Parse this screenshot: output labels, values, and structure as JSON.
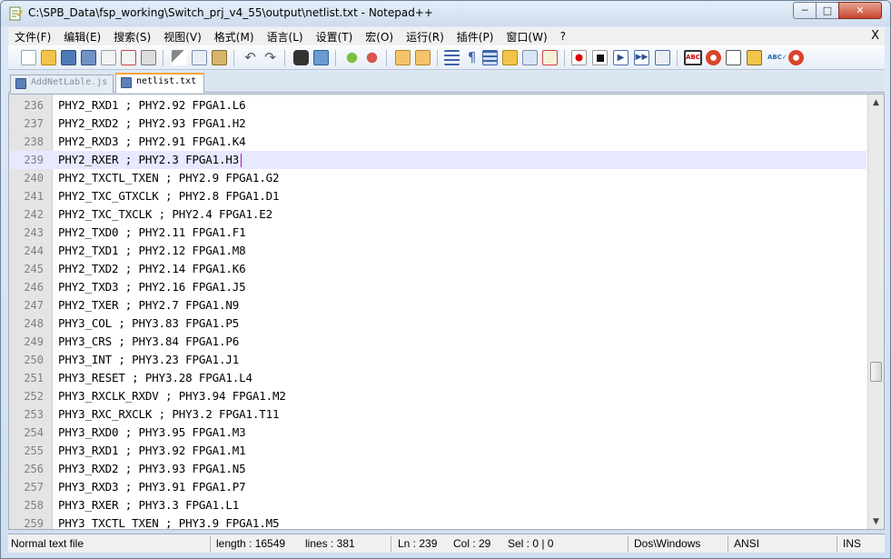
{
  "window": {
    "title": "C:\\SPB_Data\\fsp_working\\Switch_prj_v4_55\\output\\netlist.txt - Notepad++",
    "min_label": "─",
    "max_label": "□",
    "close_label": "✕"
  },
  "menu": {
    "items": [
      "文件(F)",
      "编辑(E)",
      "搜索(S)",
      "视图(V)",
      "格式(M)",
      "语言(L)",
      "设置(T)",
      "宏(O)",
      "运行(R)",
      "插件(P)",
      "窗口(W)",
      "?"
    ],
    "close_label": "X"
  },
  "toolbar": {
    "icons": [
      "new-file-icon",
      "open-file-icon",
      "save-icon",
      "save-all-icon",
      "close-icon",
      "close-all-icon",
      "print-icon",
      "cut-icon",
      "copy-icon",
      "paste-icon",
      "undo-icon",
      "redo-icon",
      "find-icon",
      "replace-icon",
      "zoom-in-icon",
      "zoom-out-icon",
      "sync-vertical-icon",
      "sync-horizontal-icon",
      "word-wrap-icon",
      "show-all-chars-icon",
      "indent-guide-icon",
      "folder-as-workspace-icon",
      "doc-map-icon",
      "function-list-icon",
      "record-macro-icon",
      "stop-macro-icon",
      "play-macro-icon",
      "run-macro-multiple-icon",
      "save-macro-icon",
      "spell-check-icon",
      "plugin-star-icon",
      "console-icon",
      "plugin-folder-icon",
      "abc-check-icon",
      "plugin-star2-icon"
    ]
  },
  "tabs": [
    {
      "label": "AddNetLable.js",
      "active": false
    },
    {
      "label": "netlist.txt",
      "active": true
    }
  ],
  "editor": {
    "current_line": 239,
    "lines": [
      {
        "n": "236",
        "text": "PHY2_RXD1 ; PHY2.92 FPGA1.L6"
      },
      {
        "n": "237",
        "text": "PHY2_RXD2 ; PHY2.93 FPGA1.H2"
      },
      {
        "n": "238",
        "text": "PHY2_RXD3 ; PHY2.91 FPGA1.K4"
      },
      {
        "n": "239",
        "text": "PHY2_RXER ; PHY2.3 FPGA1.H3"
      },
      {
        "n": "240",
        "text": "PHY2_TXCTL_TXEN ; PHY2.9 FPGA1.G2"
      },
      {
        "n": "241",
        "text": "PHY2_TXC_GTXCLK ; PHY2.8 FPGA1.D1"
      },
      {
        "n": "242",
        "text": "PHY2_TXC_TXCLK ; PHY2.4 FPGA1.E2"
      },
      {
        "n": "243",
        "text": "PHY2_TXD0 ; PHY2.11 FPGA1.F1"
      },
      {
        "n": "244",
        "text": "PHY2_TXD1 ; PHY2.12 FPGA1.M8"
      },
      {
        "n": "245",
        "text": "PHY2_TXD2 ; PHY2.14 FPGA1.K6"
      },
      {
        "n": "246",
        "text": "PHY2_TXD3 ; PHY2.16 FPGA1.J5"
      },
      {
        "n": "247",
        "text": "PHY2_TXER ; PHY2.7 FPGA1.N9"
      },
      {
        "n": "248",
        "text": "PHY3_COL ; PHY3.83 FPGA1.P5"
      },
      {
        "n": "249",
        "text": "PHY3_CRS ; PHY3.84 FPGA1.P6"
      },
      {
        "n": "250",
        "text": "PHY3_INT ; PHY3.23 FPGA1.J1"
      },
      {
        "n": "251",
        "text": "PHY3_RESET ; PHY3.28 FPGA1.L4"
      },
      {
        "n": "252",
        "text": "PHY3_RXCLK_RXDV ; PHY3.94 FPGA1.M2"
      },
      {
        "n": "253",
        "text": "PHY3_RXC_RXCLK ; PHY3.2 FPGA1.T11"
      },
      {
        "n": "254",
        "text": "PHY3_RXD0 ; PHY3.95 FPGA1.M3"
      },
      {
        "n": "255",
        "text": "PHY3_RXD1 ; PHY3.92 FPGA1.M1"
      },
      {
        "n": "256",
        "text": "PHY3_RXD2 ; PHY3.93 FPGA1.N5"
      },
      {
        "n": "257",
        "text": "PHY3_RXD3 ; PHY3.91 FPGA1.P7"
      },
      {
        "n": "258",
        "text": "PHY3_RXER ; PHY3.3 FPGA1.L1"
      },
      {
        "n": "259",
        "text": "PHY3_TXCTL_TXEN ; PHY3.9 FPGA1.M5"
      }
    ]
  },
  "status": {
    "file_type": "Normal text file",
    "length": "length : 16549",
    "lines": "lines : 381",
    "ln": "Ln : 239",
    "col": "Col : 29",
    "sel": "Sel : 0 | 0",
    "eol": "Dos\\Windows",
    "encoding": "ANSI",
    "mode": "INS"
  }
}
